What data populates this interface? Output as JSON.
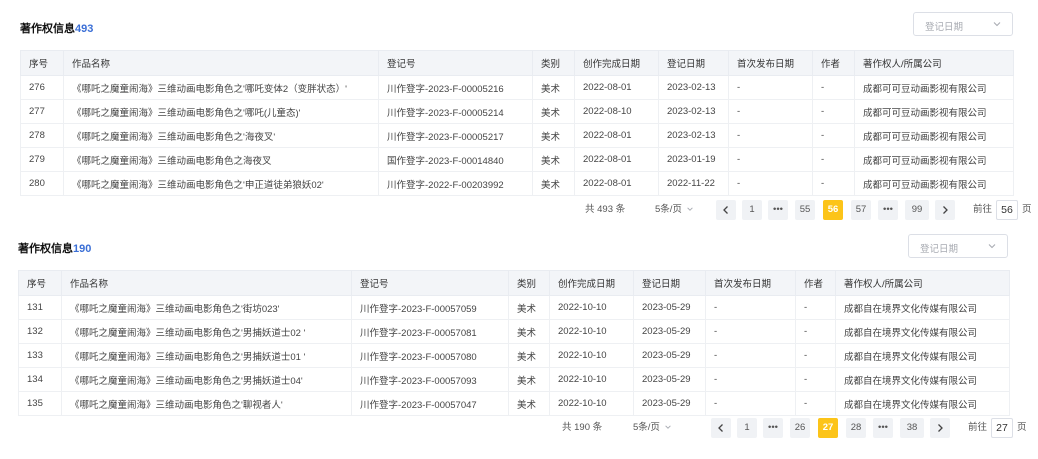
{
  "sections": [
    {
      "title": "著作权信息",
      "count": "493",
      "date_placeholder": "登记日期",
      "headers": [
        "序号",
        "作品名称",
        "登记号",
        "类别",
        "创作完成日期",
        "登记日期",
        "首次发布日期",
        "作者",
        "著作权人/所属公司"
      ],
      "rows": [
        [
          "276",
          "《哪吒之魔童闹海》三维动画电影角色之'哪吒变体2（变胖状态）'",
          "川作登字-2023-F-00005216",
          "美术",
          "2022-08-01",
          "2023-02-13",
          "-",
          "-",
          "成都可可豆动画影视有限公司"
        ],
        [
          "277",
          "《哪吒之魔童闹海》三维动画电影角色之'哪吒(儿童态)'",
          "川作登字-2023-F-00005214",
          "美术",
          "2022-08-10",
          "2023-02-13",
          "-",
          "-",
          "成都可可豆动画影视有限公司"
        ],
        [
          "278",
          "《哪吒之魔童闹海》三维动画电影角色之'海夜叉'",
          "川作登字-2023-F-00005217",
          "美术",
          "2022-08-01",
          "2023-02-13",
          "-",
          "-",
          "成都可可豆动画影视有限公司"
        ],
        [
          "279",
          "《哪吒之魔童闹海》三维动画电影角色之海夜叉",
          "国作登字-2023-F-00014840",
          "美术",
          "2022-08-01",
          "2023-01-19",
          "-",
          "-",
          "成都可可豆动画影视有限公司"
        ],
        [
          "280",
          "《哪吒之魔童闹海》三维动画电影角色之'申正道徒弟狼妖02'",
          "川作登字-2022-F-00203992",
          "美术",
          "2022-08-01",
          "2022-11-22",
          "-",
          "-",
          "成都可可豆动画影视有限公司"
        ]
      ],
      "pagination": {
        "total": "共 493 条",
        "page_size": "5条/页",
        "pages": [
          "1",
          "•••",
          "55",
          "56",
          "57",
          "•••",
          "99"
        ],
        "active": "56",
        "jump_label": "前往",
        "jump_value": "56",
        "page_suffix": "页"
      }
    },
    {
      "title": "著作权信息",
      "count": "190",
      "date_placeholder": "登记日期",
      "headers": [
        "序号",
        "作品名称",
        "登记号",
        "类别",
        "创作完成日期",
        "登记日期",
        "首次发布日期",
        "作者",
        "著作权人/所属公司"
      ],
      "rows": [
        [
          "131",
          "《哪吒之魔童闹海》三维动画电影角色之'街坊023'",
          "川作登字-2023-F-00057059",
          "美术",
          "2022-10-10",
          "2023-05-29",
          "-",
          "-",
          "成都自在境界文化传媒有限公司"
        ],
        [
          "132",
          "《哪吒之魔童闹海》三维动画电影角色之'男捕妖道士02 '",
          "川作登字-2023-F-00057081",
          "美术",
          "2022-10-10",
          "2023-05-29",
          "-",
          "-",
          "成都自在境界文化传媒有限公司"
        ],
        [
          "133",
          "《哪吒之魔童闹海》三维动画电影角色之'男捕妖道士01 '",
          "川作登字-2023-F-00057080",
          "美术",
          "2022-10-10",
          "2023-05-29",
          "-",
          "-",
          "成都自在境界文化传媒有限公司"
        ],
        [
          "134",
          "《哪吒之魔童闹海》三维动画电影角色之'男捕妖道士04'",
          "川作登字-2023-F-00057093",
          "美术",
          "2022-10-10",
          "2023-05-29",
          "-",
          "-",
          "成都自在境界文化传媒有限公司"
        ],
        [
          "135",
          "《哪吒之魔童闹海》三维动画电影角色之'聊视者人'",
          "川作登字-2023-F-00057047",
          "美术",
          "2022-10-10",
          "2023-05-29",
          "-",
          "-",
          "成都自在境界文化传媒有限公司"
        ]
      ],
      "pagination": {
        "total": "共 190 条",
        "page_size": "5条/页",
        "pages": [
          "1",
          "•••",
          "26",
          "27",
          "28",
          "•••",
          "38"
        ],
        "active": "27",
        "jump_label": "前往",
        "jump_value": "27",
        "page_suffix": "页"
      }
    }
  ],
  "colors": {
    "count": "#3b6fd6",
    "active_page": "#fcc419",
    "header_bg": "#f3f5f8"
  },
  "icons": {
    "select": "chevron-down-icon",
    "prev": "chevron-left-icon",
    "next": "chevron-right-icon"
  }
}
